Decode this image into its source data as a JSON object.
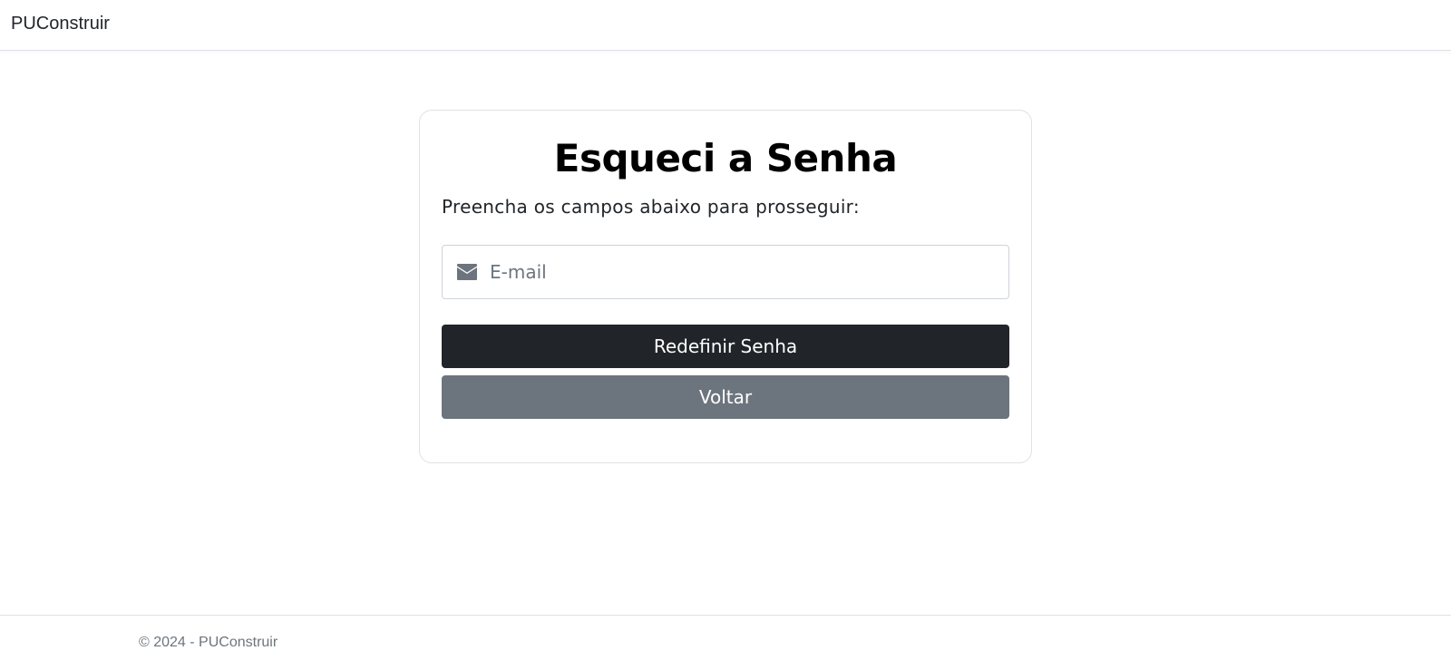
{
  "navbar": {
    "brand": "PUConstruir"
  },
  "card": {
    "title": "Esqueci a Senha",
    "subtitle": "Preencha os campos abaixo para prosseguir:",
    "email": {
      "icon": "envelope-icon",
      "placeholder": "E-mail",
      "value": ""
    },
    "buttons": {
      "reset_label": "Redefinir Senha",
      "back_label": "Voltar"
    }
  },
  "footer": {
    "text": "© 2024 - PUConstruir"
  },
  "colors": {
    "primary_dark": "#212529",
    "secondary": "#6c757d",
    "border": "#dee2e6",
    "icon": "#6c757d"
  }
}
